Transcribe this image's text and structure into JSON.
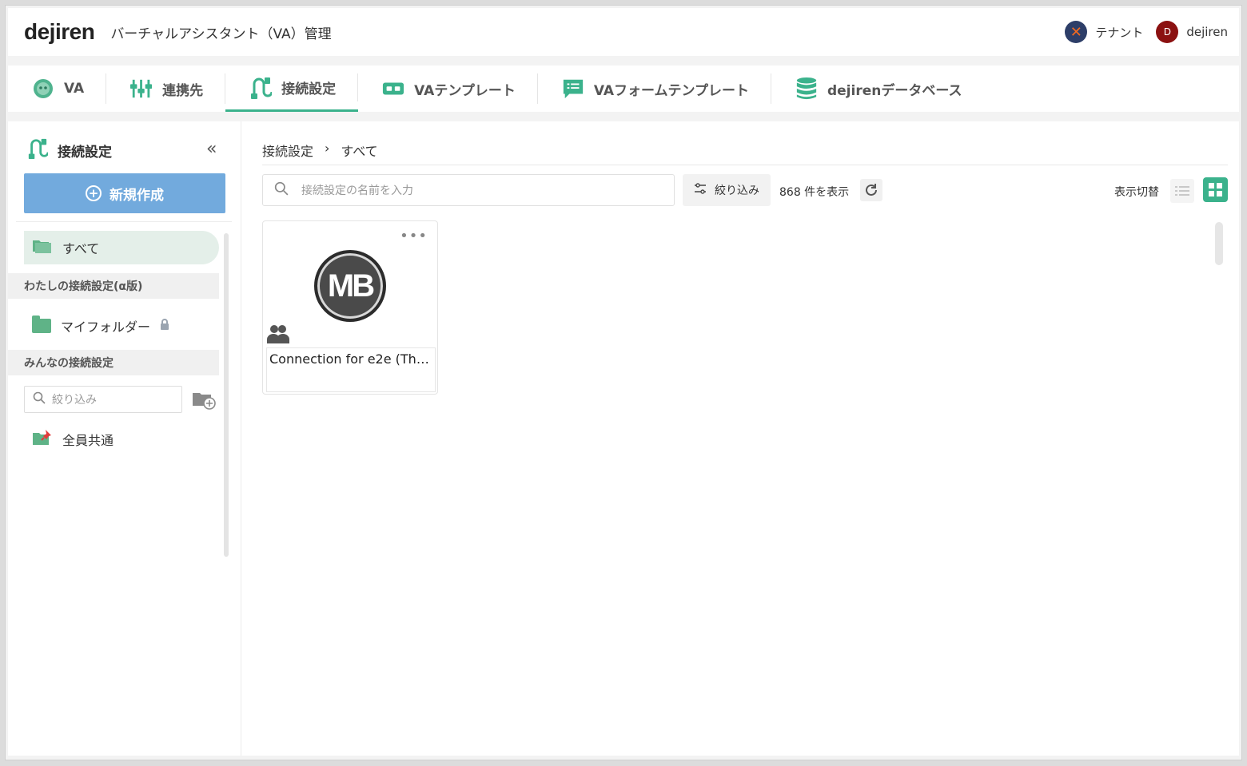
{
  "header": {
    "logo": "dejiren",
    "title": "バーチャルアシスタント（VA）管理",
    "tenant_label": "テナント",
    "user_initial": "D",
    "user_name": "dejiren"
  },
  "tabs": [
    {
      "label": "VA",
      "icon": "va-bot-icon"
    },
    {
      "label": "連携先",
      "icon": "integration-icon"
    },
    {
      "label": "接続設定",
      "icon": "connection-icon",
      "active": true
    },
    {
      "label": "VAテンプレート",
      "icon": "template-icon"
    },
    {
      "label": "VAフォームテンプレート",
      "icon": "form-template-icon"
    },
    {
      "label": "dejirenデータベース",
      "icon": "database-icon"
    }
  ],
  "sidebar": {
    "title": "接続設定",
    "new_button": "新規作成",
    "all_label": "すべて",
    "my_section": "わたしの接続設定(α版)",
    "my_folder": "マイフォルダー",
    "shared_section": "みんなの接続設定",
    "filter_placeholder": "絞り込み",
    "shared_folder": "全員共通"
  },
  "content": {
    "breadcrumb_root": "接続設定",
    "breadcrumb_sep": "›",
    "breadcrumb_current": "すべて",
    "search_placeholder": "接続設定の名前を入力",
    "filter_button": "絞り込み",
    "count_text": "868 件を表示",
    "view_toggle_label": "表示切替"
  },
  "cards": [
    {
      "logo_text": "MB",
      "name": "Connection for e2e (Th…"
    }
  ],
  "colors": {
    "accent": "#3bb28c",
    "primary_button": "#72aadd",
    "folder": "#5fb387"
  }
}
